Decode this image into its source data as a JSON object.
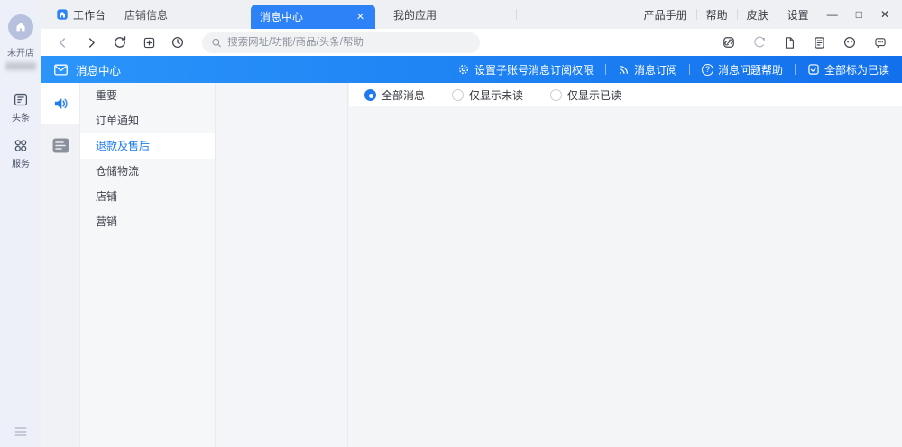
{
  "colors": {
    "accent": "#1f7cf0",
    "banner_left": "#2b95fb",
    "banner_right": "#1270ec"
  },
  "titlebar": {
    "workbench_label": "工作台",
    "shop_info_label": "店铺信息",
    "active_tab": {
      "label": "消息中心",
      "close_glyph": "✕"
    },
    "inactive_tab": {
      "label": "我的应用"
    },
    "links": {
      "manual": "产品手册",
      "help": "帮助",
      "skin": "皮肤",
      "settings": "设置"
    },
    "window_controls": {
      "minimize": "—",
      "maximize": "□",
      "close": "✕"
    }
  },
  "toolbar": {
    "search_placeholder": "搜索网址/功能/商品/头条/帮助"
  },
  "banner": {
    "title": "消息中心",
    "actions": {
      "sub_account": "设置子账号消息订阅权限",
      "subscribe": "消息订阅",
      "help": "消息问题帮助",
      "help_glyph": "?",
      "mark_all_read": "全部标为已读"
    }
  },
  "sidebar": {
    "store_status": "未开店",
    "toutiao_label": "头条",
    "service_label": "服务"
  },
  "menu": {
    "items": [
      "重要",
      "订单通知",
      "退款及售后",
      "仓储物流",
      "店铺",
      "营销"
    ],
    "selected": "退款及售后",
    "selected_index": 2
  },
  "filters": {
    "options": [
      {
        "label": "全部消息",
        "selected": true
      },
      {
        "label": "仅显示未读",
        "selected": false
      },
      {
        "label": "仅显示已读",
        "selected": false
      }
    ]
  }
}
